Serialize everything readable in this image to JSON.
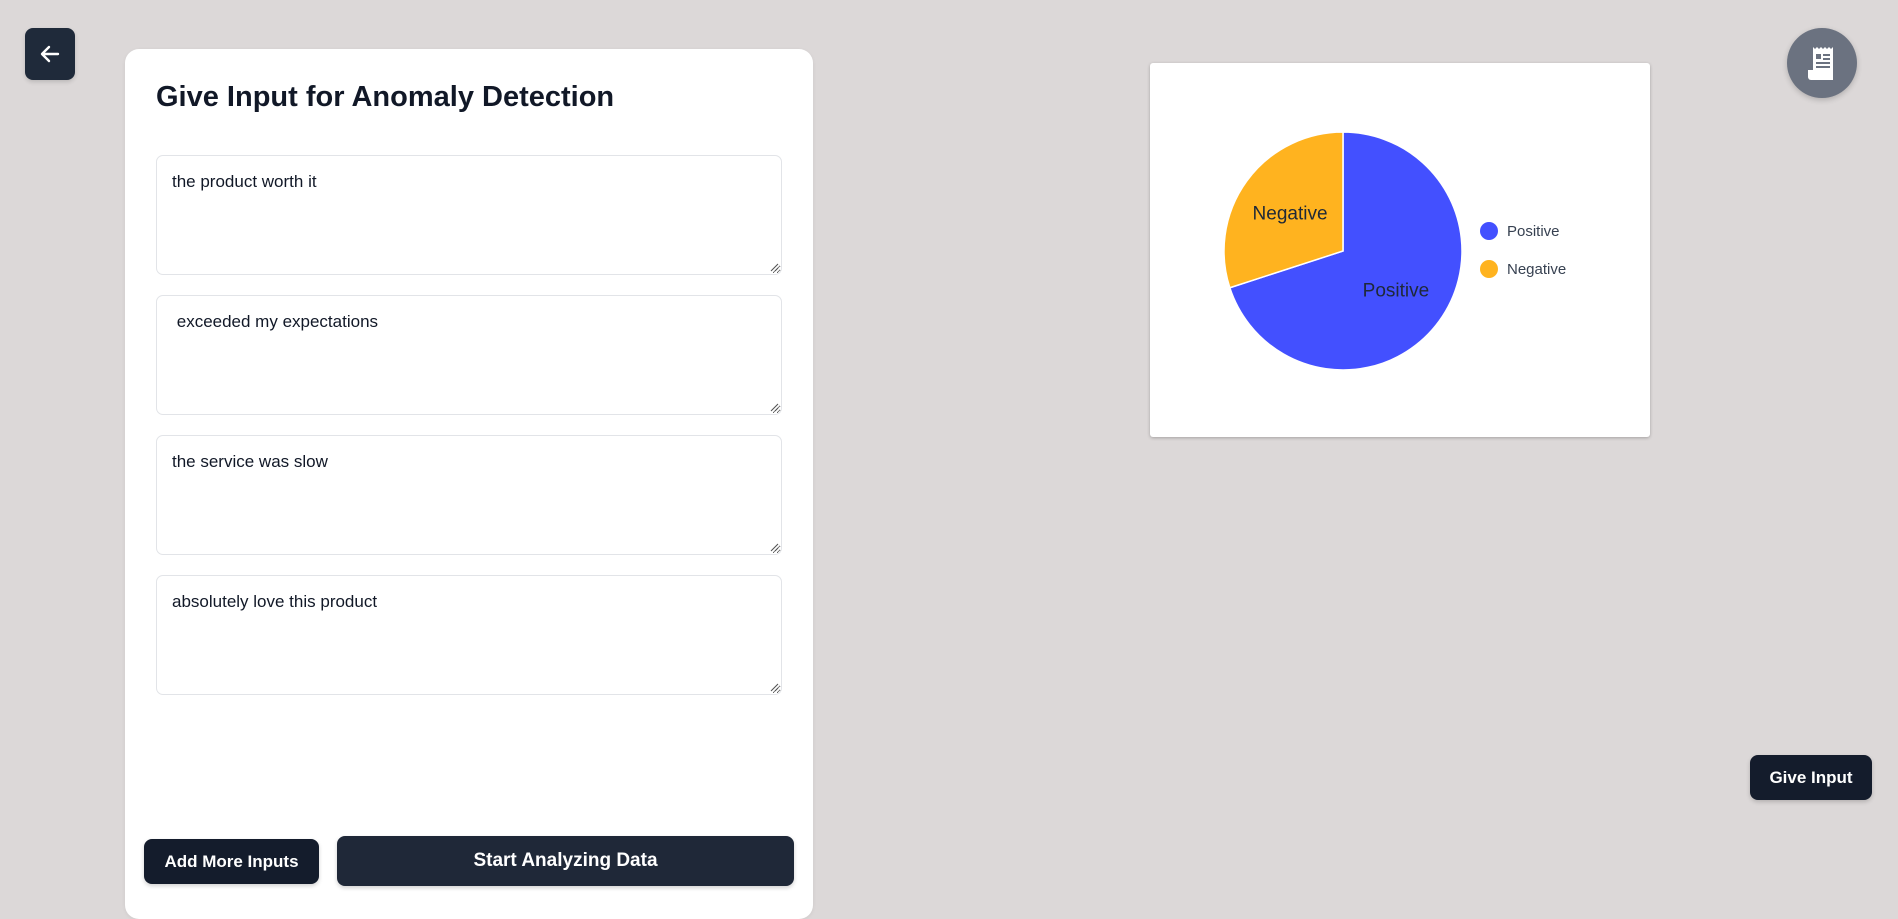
{
  "nav": {
    "back_icon": "arrow-left-icon",
    "report_icon": "receipt-icon"
  },
  "panel": {
    "title": "Give Input for Anomaly Detection",
    "inputs": [
      {
        "value": "the product worth it"
      },
      {
        "value": " exceeded my expectations"
      },
      {
        "value": "the service was slow"
      },
      {
        "value": "absolutely love this product"
      }
    ],
    "add_more_label": "Add More Inputs",
    "start_label": "Start Analyzing Data"
  },
  "give_input_label": "Give Input",
  "colors": {
    "page_bg": "#dcd8d8",
    "button_dark": "#141c2c",
    "positive": "#4350ff",
    "negative": "#ffb31f"
  },
  "chart_data": {
    "type": "pie",
    "categories": [
      "Positive",
      "Negative"
    ],
    "values": [
      70,
      30
    ],
    "colors": [
      "#4350ff",
      "#ffb31f"
    ],
    "legend": [
      "Positive",
      "Negative"
    ],
    "legend_position": "right",
    "start_angle": "top",
    "direction": "clockwise"
  }
}
